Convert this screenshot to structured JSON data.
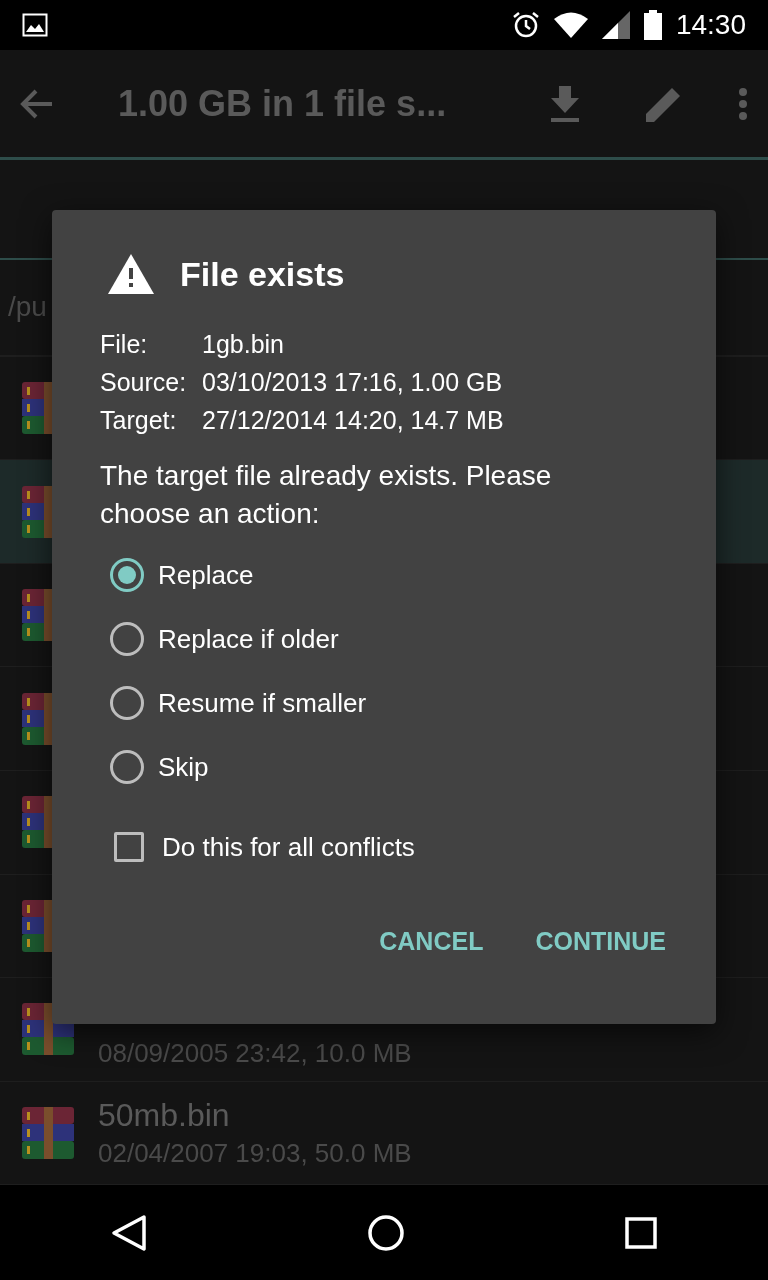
{
  "status_bar": {
    "time": "14:30"
  },
  "toolbar": {
    "title": "1.00 GB in 1 file s..."
  },
  "path": "/pu",
  "files": [
    {
      "selected": false
    },
    {
      "selected": true
    },
    {
      "selected": false
    },
    {
      "selected": false
    },
    {
      "selected": false
    },
    {
      "selected": false
    },
    {
      "selected": false,
      "detail": "08/09/2005 23:42, 10.0 MB"
    },
    {
      "selected": false,
      "name": "50mb.bin",
      "detail": "02/04/2007 19:03, 50.0 MB"
    }
  ],
  "dialog": {
    "title": "File exists",
    "info": [
      {
        "label": "File:",
        "value": "1gb.bin"
      },
      {
        "label": "Source:",
        "value": "03/10/2013 17:16, 1.00 GB"
      },
      {
        "label": "Target:",
        "value": "27/12/2014 14:20, 14.7 MB"
      }
    ],
    "message": "The target file already exists. Please choose an action:",
    "options": [
      {
        "label": "Replace",
        "selected": true
      },
      {
        "label": "Replace if older",
        "selected": false
      },
      {
        "label": "Resume if smaller",
        "selected": false
      },
      {
        "label": "Skip",
        "selected": false
      }
    ],
    "apply_all": {
      "label": "Do this for all conflicts",
      "checked": false
    },
    "buttons": [
      "CANCEL",
      "CONTINUE"
    ]
  }
}
